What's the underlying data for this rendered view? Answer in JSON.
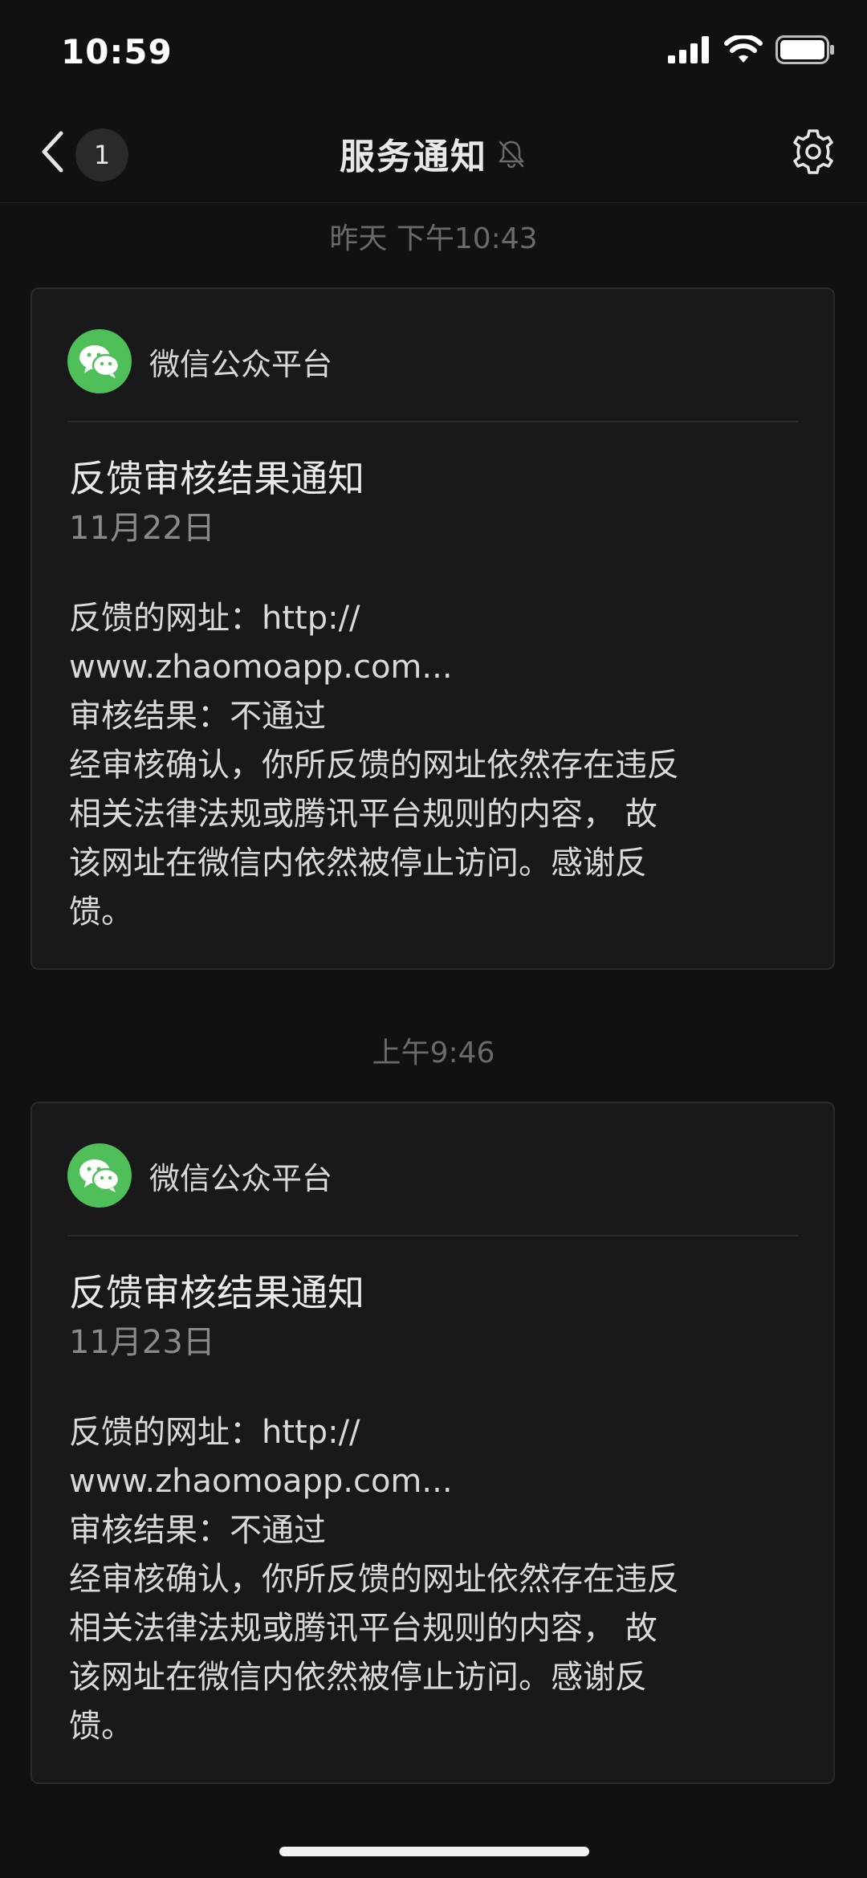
{
  "status_bar": {
    "time": "10:59",
    "icons": [
      "signal-icon",
      "wifi-icon",
      "battery-icon"
    ]
  },
  "nav": {
    "unread_count": "1",
    "title": "服务通知",
    "icons": [
      "back-chevron-icon",
      "mute-bell-icon",
      "gear-icon"
    ]
  },
  "messages": [
    {
      "timestamp": "昨天 下午10:43",
      "source": "微信公众平台",
      "title": "反馈审核结果通知",
      "date": "11月22日",
      "body_lines": [
        "反馈的网址：http://",
        "www.zhaomoapp.com...",
        "审核结果：不通过",
        "经审核确认，你所反馈的网址依然存在违反",
        "相关法律法规或腾讯平台规则的内容，  故",
        "该网址在微信内依然被停止访问。感谢反",
        "馈。"
      ]
    },
    {
      "timestamp": "上午9:46",
      "source": "微信公众平台",
      "title": "反馈审核结果通知",
      "date": "11月23日",
      "body_lines": [
        "反馈的网址：http://",
        "www.zhaomoapp.com...",
        "审核结果：不通过",
        "经审核确认，你所反馈的网址依然存在违反",
        "相关法律法规或腾讯平台规则的内容，  故",
        "该网址在微信内依然被停止访问。感谢反",
        "馈。"
      ]
    }
  ],
  "colors": {
    "background": "#111111",
    "card": "#191919",
    "logo_green": "#4fbf5a"
  }
}
